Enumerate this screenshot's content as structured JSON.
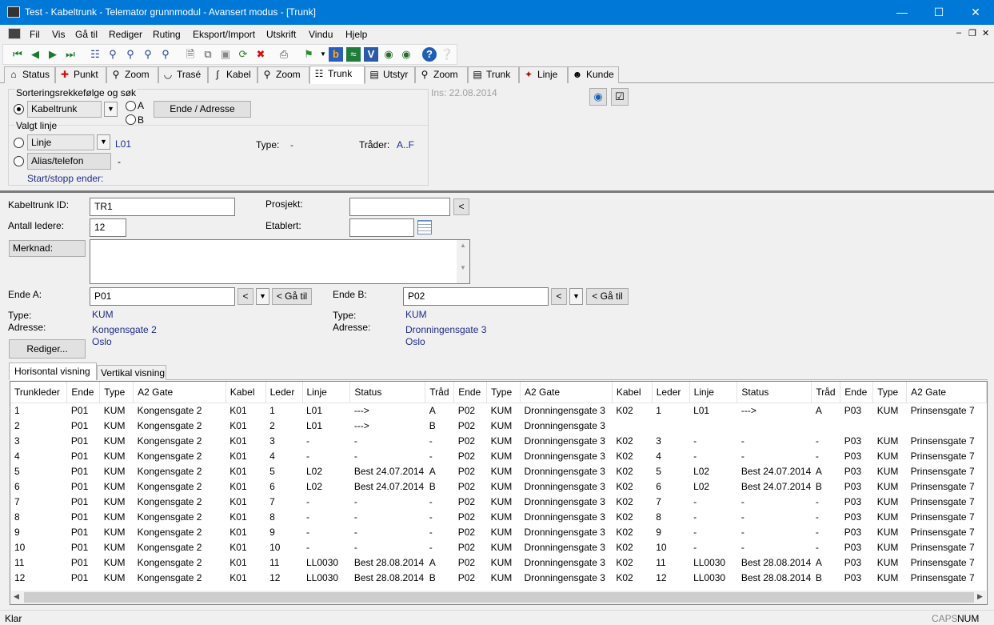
{
  "window": {
    "title": "Test - Kabeltrunk - Telemator grunnmodul - Avansert modus - [Trunk]"
  },
  "menu": [
    "Fil",
    "Vis",
    "Gå til",
    "Rediger",
    "Ruting",
    "Eksport/Import",
    "Utskrift",
    "Vindu",
    "Hjelp"
  ],
  "tabs": [
    {
      "label": "Status",
      "icon": "home-icon"
    },
    {
      "label": "Punkt",
      "icon": "crosshair-icon"
    },
    {
      "label": "Zoom",
      "icon": "zoom-icon"
    },
    {
      "label": "Trasé",
      "icon": "route-icon"
    },
    {
      "label": "Kabel",
      "icon": "cable-icon"
    },
    {
      "label": "Zoom",
      "icon": "zoom-icon"
    },
    {
      "label": "Trunk",
      "icon": "trunk-icon"
    },
    {
      "label": "Utstyr",
      "icon": "equipment-icon"
    },
    {
      "label": "Zoom",
      "icon": "zoom-icon"
    },
    {
      "label": "Trunk",
      "icon": "trunk-icon"
    },
    {
      "label": "Linje",
      "icon": "line-icon"
    },
    {
      "label": "Kunde",
      "icon": "customer-icon"
    }
  ],
  "search": {
    "group_label": "Sorteringsrekkefølge og søk",
    "sort_value": "Kabeltrunk",
    "radio_a": "A",
    "radio_b": "B",
    "end_address_button": "Ende / Adresse",
    "selected_line_label": "Valgt linje",
    "line_value": "Linje",
    "line_id": "L01",
    "alias_button": "Alias/telefon",
    "alias_value": "-",
    "start_stop_label": "Start/stopp ender:",
    "type_label": "Type:",
    "type_value": "-",
    "threads_label": "Tråder:",
    "threads_value": "A..F",
    "inserted": "Ins: 22.08.2014"
  },
  "form": {
    "trunk_id_label": "Kabeltrunk ID:",
    "trunk_id": "TR1",
    "conductors_label": "Antall ledere:",
    "conductors": "12",
    "project_label": "Prosjekt:",
    "project": "",
    "established_label": "Etablert:",
    "established": "",
    "note_button": "Merknad:",
    "end_a_label": "Ende A:",
    "end_a": "P01",
    "end_b_label": "Ende B:",
    "end_b": "P02",
    "goto_button": "< Gå til",
    "lt_button": "<",
    "type_label": "Type:",
    "address_label": "Adresse:",
    "end_a_type": "KUM",
    "end_a_street": "Kongensgate 2",
    "end_a_city": "Oslo",
    "end_b_type": "KUM",
    "end_b_street": "Dronningensgate 3",
    "end_b_city": "Oslo",
    "edit_button": "Rediger..."
  },
  "view_tabs": [
    "Horisontal visning",
    "Vertikal visning"
  ],
  "grid": {
    "columns": [
      "Trunkleder",
      "Ende",
      "Type",
      "A2 Gate",
      "Kabel",
      "Leder",
      "Linje",
      "Status",
      "Tråd",
      "Ende",
      "Type",
      "A2 Gate",
      "Kabel",
      "Leder",
      "Linje",
      "Status",
      "Tråd",
      "Ende",
      "Type",
      "A2 Gate"
    ],
    "rows": [
      [
        "1",
        "P01",
        "KUM",
        "Kongensgate 2",
        "K01",
        "1",
        "L01",
        "--->",
        "A",
        "P02",
        "KUM",
        "Dronningensgate 3",
        "K02",
        "1",
        "L01",
        "--->",
        "A",
        "P03",
        "KUM",
        "Prinsensgate 7"
      ],
      [
        "2",
        "P01",
        "KUM",
        "Kongensgate 2",
        "K01",
        "2",
        "L01",
        "--->",
        "B",
        "P02",
        "KUM",
        "Dronningensgate 3",
        "",
        "",
        "",
        "",
        "",
        "",
        "",
        ""
      ],
      [
        "3",
        "P01",
        "KUM",
        "Kongensgate 2",
        "K01",
        "3",
        "-",
        "-",
        "-",
        "P02",
        "KUM",
        "Dronningensgate 3",
        "K02",
        "3",
        "-",
        "-",
        "-",
        "P03",
        "KUM",
        "Prinsensgate 7"
      ],
      [
        "4",
        "P01",
        "KUM",
        "Kongensgate 2",
        "K01",
        "4",
        "-",
        "-",
        "-",
        "P02",
        "KUM",
        "Dronningensgate 3",
        "K02",
        "4",
        "-",
        "-",
        "-",
        "P03",
        "KUM",
        "Prinsensgate 7"
      ],
      [
        "5",
        "P01",
        "KUM",
        "Kongensgate 2",
        "K01",
        "5",
        "L02",
        "Best 24.07.2014",
        "A",
        "P02",
        "KUM",
        "Dronningensgate 3",
        "K02",
        "5",
        "L02",
        "Best 24.07.2014",
        "A",
        "P03",
        "KUM",
        "Prinsensgate 7"
      ],
      [
        "6",
        "P01",
        "KUM",
        "Kongensgate 2",
        "K01",
        "6",
        "L02",
        "Best 24.07.2014",
        "B",
        "P02",
        "KUM",
        "Dronningensgate 3",
        "K02",
        "6",
        "L02",
        "Best 24.07.2014",
        "B",
        "P03",
        "KUM",
        "Prinsensgate 7"
      ],
      [
        "7",
        "P01",
        "KUM",
        "Kongensgate 2",
        "K01",
        "7",
        "-",
        "-",
        "-",
        "P02",
        "KUM",
        "Dronningensgate 3",
        "K02",
        "7",
        "-",
        "-",
        "-",
        "P03",
        "KUM",
        "Prinsensgate 7"
      ],
      [
        "8",
        "P01",
        "KUM",
        "Kongensgate 2",
        "K01",
        "8",
        "-",
        "-",
        "-",
        "P02",
        "KUM",
        "Dronningensgate 3",
        "K02",
        "8",
        "-",
        "-",
        "-",
        "P03",
        "KUM",
        "Prinsensgate 7"
      ],
      [
        "9",
        "P01",
        "KUM",
        "Kongensgate 2",
        "K01",
        "9",
        "-",
        "-",
        "-",
        "P02",
        "KUM",
        "Dronningensgate 3",
        "K02",
        "9",
        "-",
        "-",
        "-",
        "P03",
        "KUM",
        "Prinsensgate 7"
      ],
      [
        "10",
        "P01",
        "KUM",
        "Kongensgate 2",
        "K01",
        "10",
        "-",
        "-",
        "-",
        "P02",
        "KUM",
        "Dronningensgate 3",
        "K02",
        "10",
        "-",
        "-",
        "-",
        "P03",
        "KUM",
        "Prinsensgate 7"
      ],
      [
        "11",
        "P01",
        "KUM",
        "Kongensgate 2",
        "K01",
        "11",
        "LL0030",
        "Best 28.08.2014",
        "A",
        "P02",
        "KUM",
        "Dronningensgate 3",
        "K02",
        "11",
        "LL0030",
        "Best 28.08.2014",
        "A",
        "P03",
        "KUM",
        "Prinsensgate 7"
      ],
      [
        "12",
        "P01",
        "KUM",
        "Kongensgate 2",
        "K01",
        "12",
        "LL0030",
        "Best 28.08.2014",
        "B",
        "P02",
        "KUM",
        "Dronningensgate 3",
        "K02",
        "12",
        "LL0030",
        "Best 28.08.2014",
        "B",
        "P03",
        "KUM",
        "Prinsensgate 7"
      ]
    ]
  },
  "status": {
    "text": "Klar",
    "caps": "CAPS",
    "num": "NUM"
  }
}
